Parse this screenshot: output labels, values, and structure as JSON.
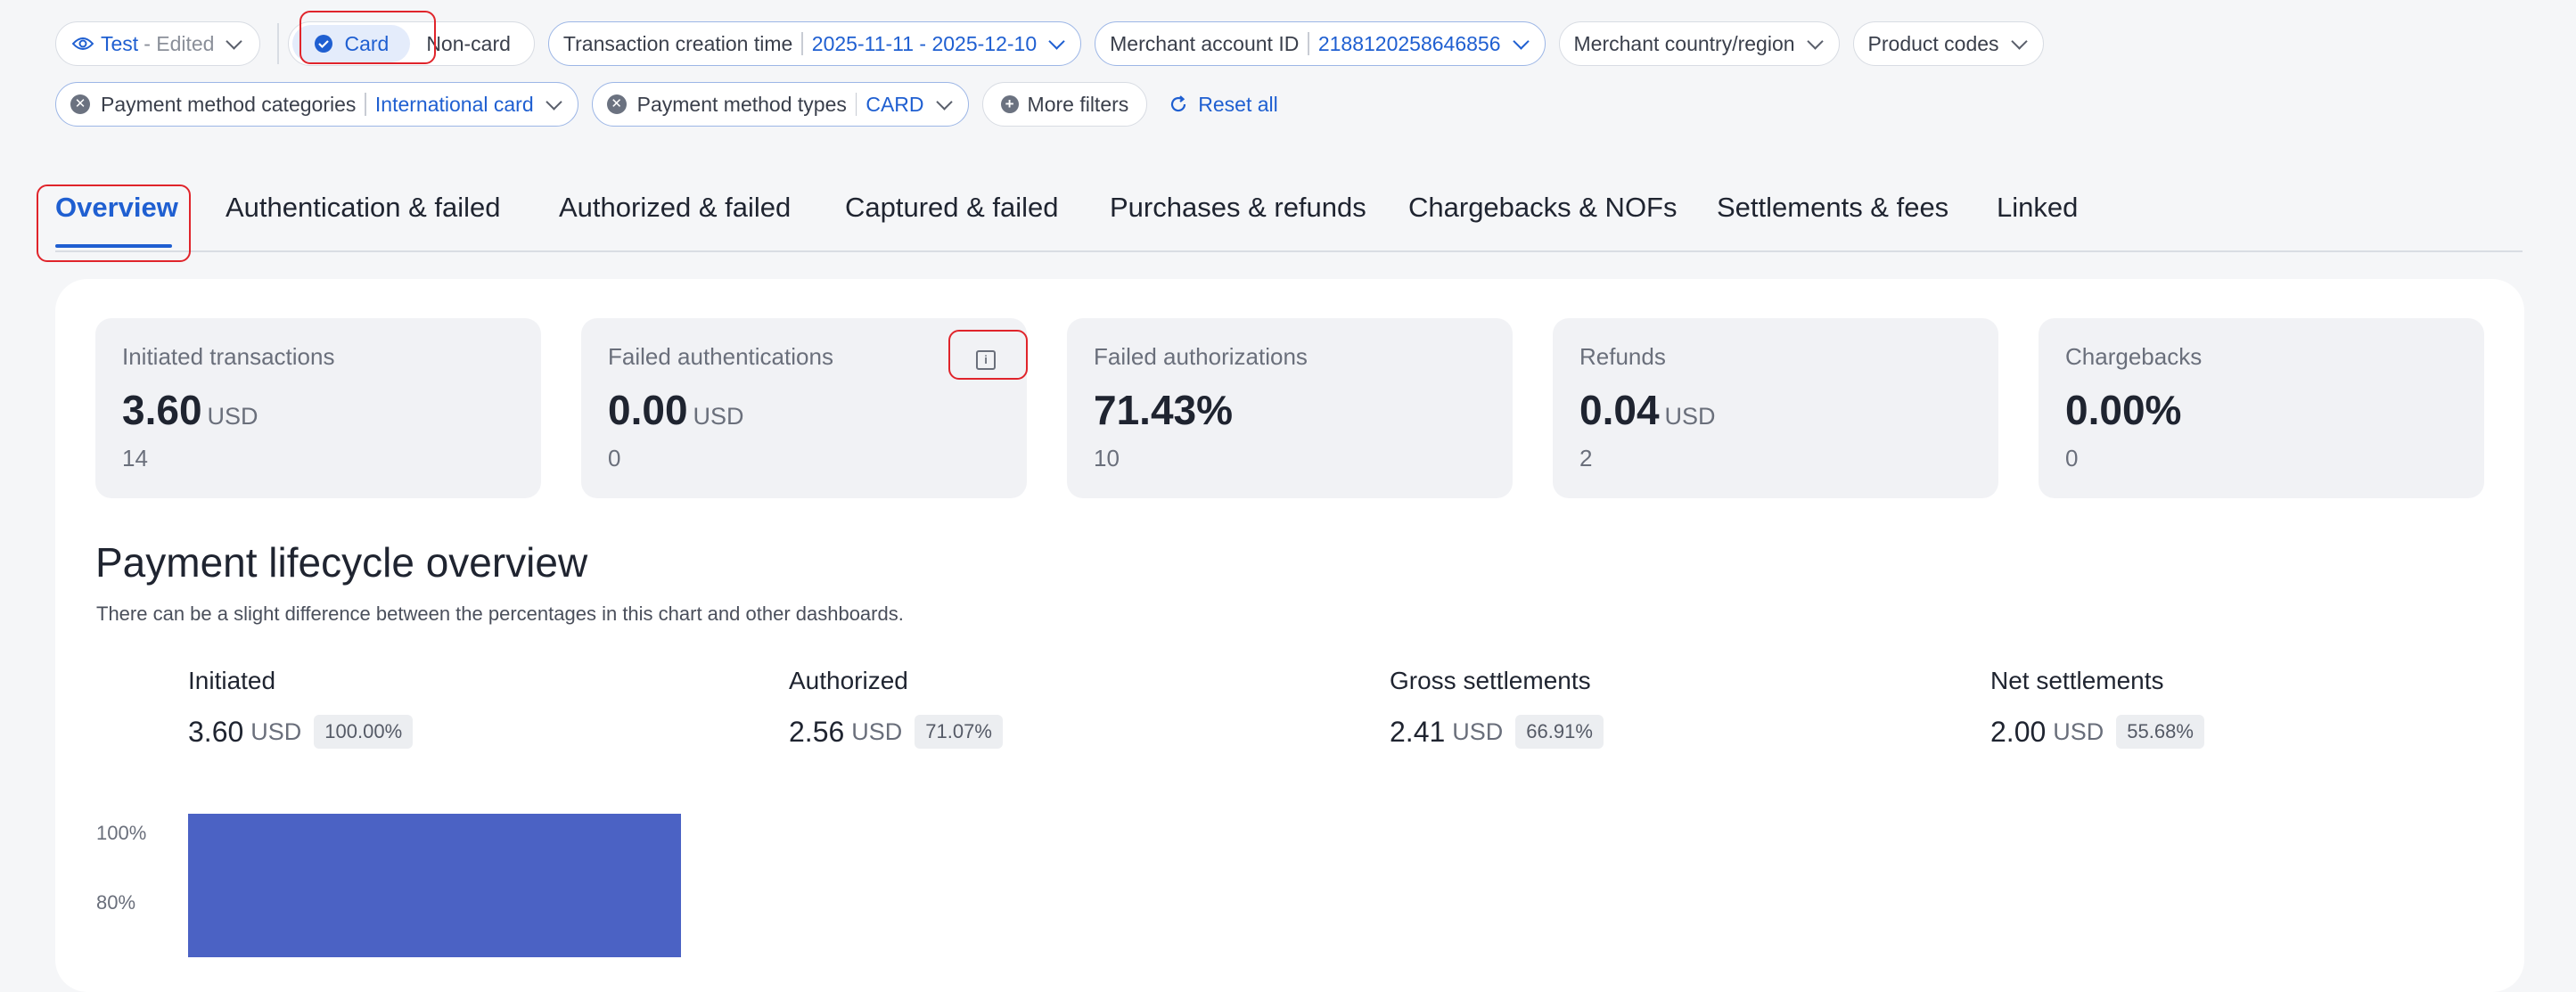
{
  "filters_row1": {
    "test_label": "Test",
    "test_suffix": "- Edited",
    "card_label": "Card",
    "noncard_label": "Non-card",
    "creation_time_label": "Transaction creation time",
    "creation_time_value": "2025-11-11 - 2025-12-10",
    "merchant_account_label": "Merchant account ID",
    "merchant_account_value": "2188120258646856",
    "merchant_country_label": "Merchant country/region",
    "product_codes_label": "Product codes"
  },
  "filters_row2": {
    "pm_categories_label": "Payment method categories",
    "pm_categories_value": "International card",
    "pm_types_label": "Payment method types",
    "pm_types_value": "CARD",
    "more_filters_label": "More filters",
    "reset_label": "Reset all"
  },
  "tabs": [
    {
      "label": "Overview"
    },
    {
      "label": "Authentication & failed"
    },
    {
      "label": "Authorized & failed"
    },
    {
      "label": "Captured & failed"
    },
    {
      "label": "Purchases & refunds"
    },
    {
      "label": "Chargebacks & NOFs"
    },
    {
      "label": "Settlements & fees"
    },
    {
      "label": "Linked"
    }
  ],
  "metrics": [
    {
      "label": "Initiated transactions",
      "value": "3.60",
      "unit": "USD",
      "count": "14"
    },
    {
      "label": "Failed authentications",
      "value": "0.00",
      "unit": "USD",
      "count": "0"
    },
    {
      "label": "Failed authorizations",
      "value": "71.43%",
      "unit": "",
      "count": "10"
    },
    {
      "label": "Refunds",
      "value": "0.04",
      "unit": "USD",
      "count": "2"
    },
    {
      "label": "Chargebacks",
      "value": "0.00%",
      "unit": "",
      "count": "0"
    }
  ],
  "lifecycle": {
    "title": "Payment lifecycle overview",
    "subtitle": "There can be a slight difference between the percentages in this chart and other dashboards."
  },
  "chart_data": {
    "type": "bar",
    "categories": [
      "Initiated",
      "Authorized",
      "Gross settlements",
      "Net settlements"
    ],
    "values": [
      100.0,
      71.07,
      66.91,
      55.68
    ],
    "amounts": [
      "3.60",
      "2.56",
      "2.41",
      "2.00"
    ],
    "unit": "USD",
    "pct_labels": [
      "100.00%",
      "71.07%",
      "66.91%",
      "55.68%"
    ],
    "y_ticks": [
      "100%",
      "80%"
    ],
    "ylim": [
      0,
      100
    ],
    "color": "#4b62c4"
  },
  "colors": {
    "accent": "#1f5fd1",
    "bar": "#4b62c4",
    "highlight": "#e0242b"
  }
}
